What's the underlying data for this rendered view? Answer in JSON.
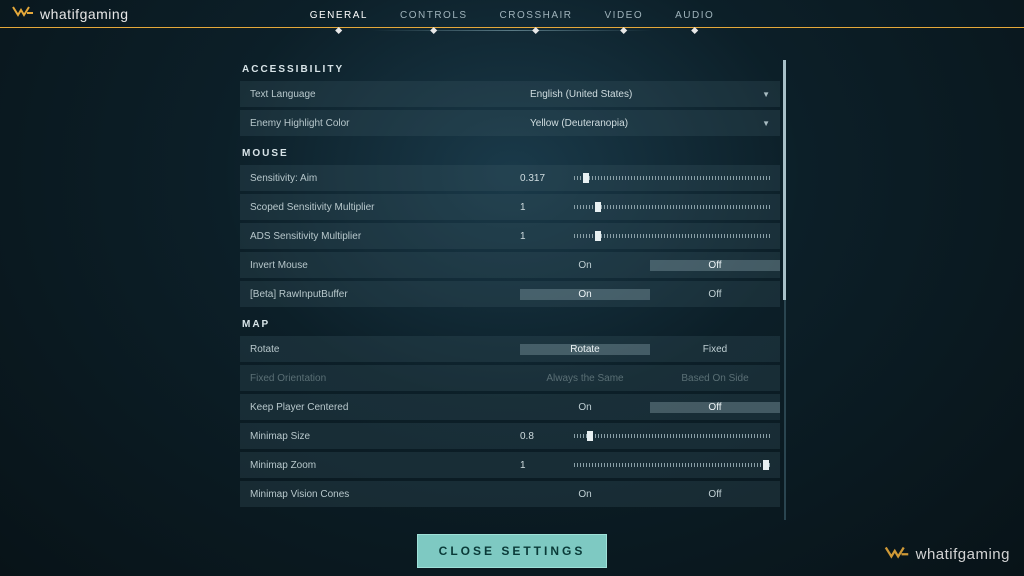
{
  "brand": "whatifgaming",
  "tabs": [
    "GENERAL",
    "CONTROLS",
    "CROSSHAIR",
    "VIDEO",
    "AUDIO"
  ],
  "active_tab": "GENERAL",
  "sections": {
    "accessibility": {
      "title": "ACCESSIBILITY",
      "text_language": {
        "label": "Text Language",
        "value": "English (United States)"
      },
      "enemy_highlight": {
        "label": "Enemy Highlight Color",
        "value": "Yellow (Deuteranopia)"
      }
    },
    "mouse": {
      "title": "MOUSE",
      "sens_aim": {
        "label": "Sensitivity: Aim",
        "value": "0.317",
        "pct": 6
      },
      "scoped_mult": {
        "label": "Scoped Sensitivity Multiplier",
        "value": "1",
        "pct": 12
      },
      "ads_mult": {
        "label": "ADS Sensitivity Multiplier",
        "value": "1",
        "pct": 12
      },
      "invert": {
        "label": "Invert Mouse",
        "on": "On",
        "off": "Off",
        "selected": "off"
      },
      "raw_input": {
        "label": "[Beta] RawInputBuffer",
        "on": "On",
        "off": "Off",
        "selected": "on"
      }
    },
    "map": {
      "title": "MAP",
      "rotate": {
        "label": "Rotate",
        "a": "Rotate",
        "b": "Fixed",
        "selected": "a"
      },
      "fixed_orient": {
        "label": "Fixed Orientation",
        "a": "Always the Same",
        "b": "Based On Side",
        "disabled": true
      },
      "keep_centered": {
        "label": "Keep Player Centered",
        "on": "On",
        "off": "Off",
        "selected": "off"
      },
      "minimap_size": {
        "label": "Minimap Size",
        "value": "0.8",
        "pct": 8
      },
      "minimap_zoom": {
        "label": "Minimap Zoom",
        "value": "1",
        "pct": 98
      },
      "vision_cones": {
        "label": "Minimap Vision Cones",
        "on": "On",
        "off": "Off",
        "selected": "on"
      }
    }
  },
  "close_label": "CLOSE SETTINGS"
}
